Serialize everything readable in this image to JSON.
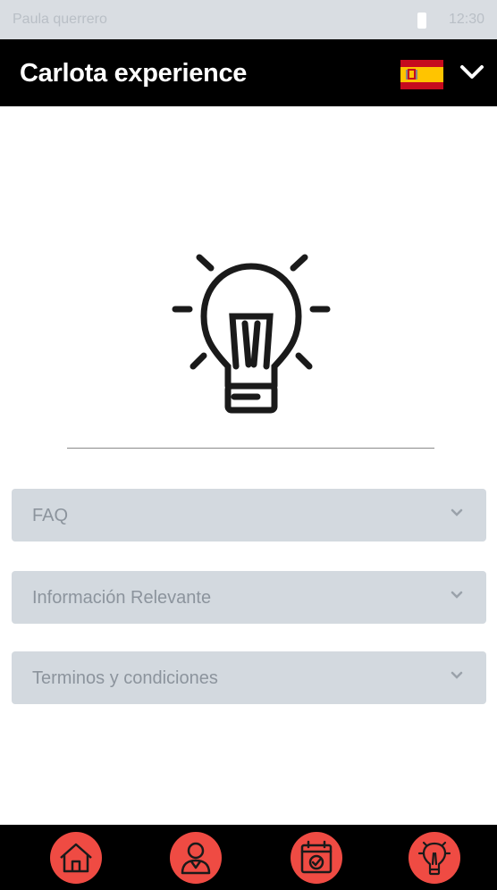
{
  "status_bar": {
    "user_name": "Paula querrero",
    "time": "12:30"
  },
  "header": {
    "title": "Carlota experience",
    "language_flag_icon": "spain-flag-icon",
    "dropdown_icon": "chevron-down-icon"
  },
  "hero": {
    "icon": "lightbulb-icon"
  },
  "sections": [
    {
      "label": "FAQ"
    },
    {
      "label": "Información Relevante"
    },
    {
      "label": "Terminos y condiciones"
    }
  ],
  "bottom_nav": {
    "items": [
      {
        "icon": "home-icon"
      },
      {
        "icon": "user-profile-icon"
      },
      {
        "icon": "calendar-check-icon"
      },
      {
        "icon": "lightbulb-icon"
      }
    ]
  },
  "colors": {
    "header_bg": "#000000",
    "nav_accent": "#ef4b43",
    "accordion_bg": "#d3d9df",
    "status_bar_bg": "#d9dde2"
  }
}
